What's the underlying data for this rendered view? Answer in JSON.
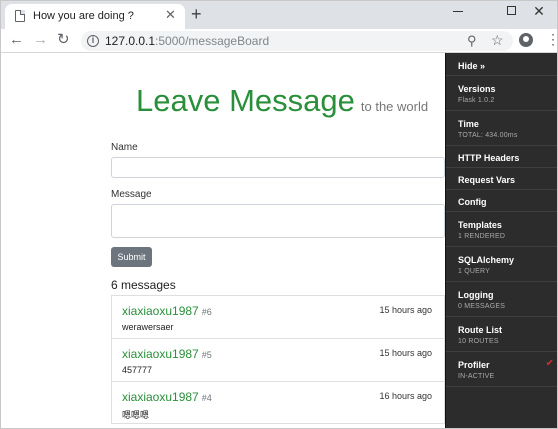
{
  "browser": {
    "tab_title": "How you are doing ?",
    "url_host": "127.0.0.1",
    "url_path": ":5000/messageBoard"
  },
  "page": {
    "title": "Leave Message",
    "subtitle": "to the world",
    "name_label": "Name",
    "message_label": "Message",
    "submit_label": "Submit",
    "count_label": "6 messages",
    "messages": [
      {
        "author": "xiaxiaoxu1987",
        "number": "#6",
        "time": "15 hours ago",
        "body": "werawersaer"
      },
      {
        "author": "xiaxiaoxu1987",
        "number": "#5",
        "time": "15 hours ago",
        "body": "457777"
      },
      {
        "author": "xiaxiaoxu1987",
        "number": "#4",
        "time": "16 hours ago",
        "body": "嗯嗯嗯"
      }
    ]
  },
  "debug_toolbar": {
    "hide_label": "Hide »",
    "panels": [
      {
        "label": "Versions",
        "sub": "Flask 1.0.2"
      },
      {
        "label": "Time",
        "sub": "TOTAL: 434.00ms"
      },
      {
        "label": "HTTP Headers",
        "sub": ""
      },
      {
        "label": "Request Vars",
        "sub": ""
      },
      {
        "label": "Config",
        "sub": ""
      },
      {
        "label": "Templates",
        "sub": "1 RENDERED"
      },
      {
        "label": "SQLAlchemy",
        "sub": "1 QUERY"
      },
      {
        "label": "Logging",
        "sub": "0 MESSAGES"
      },
      {
        "label": "Route List",
        "sub": "10 ROUTES"
      },
      {
        "label": "Profiler",
        "sub": "IN-ACTIVE"
      }
    ]
  },
  "colors": {
    "accent_green": "#2a8f3a",
    "toolbar_bg": "#2c2c2c",
    "check_red": "#d32f2f"
  }
}
